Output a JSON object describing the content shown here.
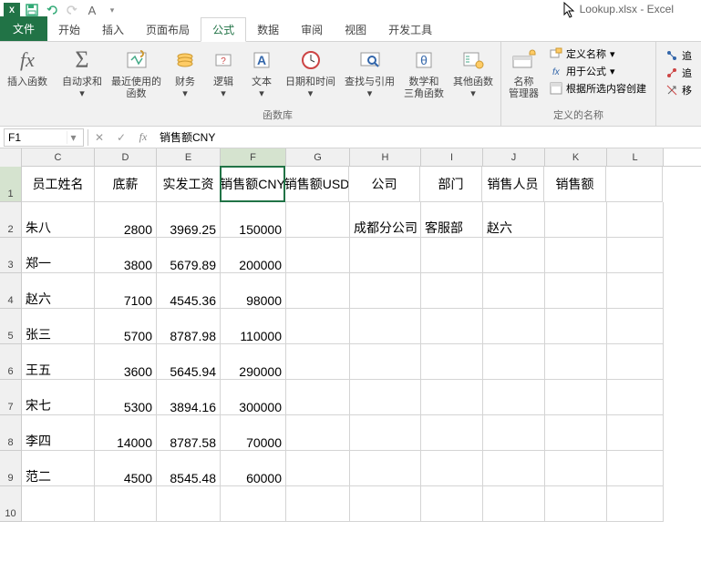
{
  "title": "Lookup.xlsx - Excel",
  "qat_letter": "A",
  "tabs": {
    "file": "文件",
    "items": [
      "开始",
      "插入",
      "页面布局",
      "公式",
      "数据",
      "审阅",
      "视图",
      "开发工具"
    ],
    "active": 3
  },
  "ribbon": {
    "insert_function": "插入函数",
    "fx": "fx",
    "autosum": "自动求和",
    "recent": "最近使用的\n函数",
    "financial": "财务",
    "logical": "逻辑",
    "text": "文本",
    "datetime": "日期和时间",
    "lookup": "查找与引用",
    "math": "数学和\n三角函数",
    "other": "其他函数",
    "library_label": "函数库",
    "name_manager": "名称\n管理器",
    "define_name": "定义名称",
    "use_in_formula": "用于公式",
    "create_from_selection": "根据所选内容创建",
    "defined_names_label": "定义的名称",
    "trace": "追",
    "trace2": "追",
    "move": "移"
  },
  "namebox": "F1",
  "formula_value": "销售额CNY",
  "columns": [
    "C",
    "D",
    "E",
    "F",
    "G",
    "H",
    "I",
    "J",
    "K",
    "L"
  ],
  "active_col": "F",
  "rows_shown": 10,
  "active_row": 1,
  "headers": {
    "C": "员工姓名",
    "D": "底薪",
    "E": "实发工资",
    "F": "销售额CNY",
    "G": "销售额USD",
    "H": "公司",
    "I": "部门",
    "J": "销售人员",
    "K": "销售额"
  },
  "data": [
    {
      "C": "朱八",
      "D": "2800",
      "E": "3969.25",
      "F": "150000",
      "H": "成都分公司",
      "I": "客服部",
      "J": "赵六"
    },
    {
      "C": "郑一",
      "D": "3800",
      "E": "5679.89",
      "F": "200000"
    },
    {
      "C": "赵六",
      "D": "7100",
      "E": "4545.36",
      "F": "98000"
    },
    {
      "C": "张三",
      "D": "5700",
      "E": "8787.98",
      "F": "110000"
    },
    {
      "C": "王五",
      "D": "3600",
      "E": "5645.94",
      "F": "290000"
    },
    {
      "C": "宋七",
      "D": "5300",
      "E": "3894.16",
      "F": "300000"
    },
    {
      "C": "李四",
      "D": "14000",
      "E": "8787.58",
      "F": "70000"
    },
    {
      "C": "范二",
      "D": "4500",
      "E": "8545.48",
      "F": "60000"
    }
  ]
}
